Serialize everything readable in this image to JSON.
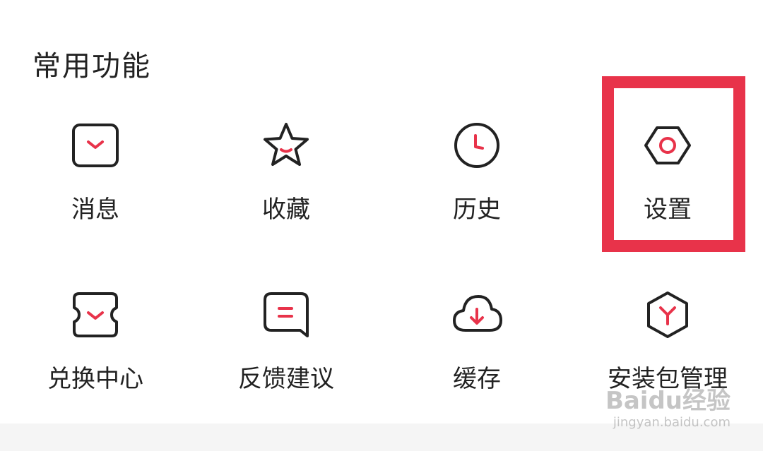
{
  "section": {
    "title": "常用功能"
  },
  "items": [
    {
      "label": "消息",
      "icon": "message-icon"
    },
    {
      "label": "收藏",
      "icon": "star-icon"
    },
    {
      "label": "历史",
      "icon": "clock-icon"
    },
    {
      "label": "设置",
      "icon": "settings-icon"
    },
    {
      "label": "兑换中心",
      "icon": "ticket-icon"
    },
    {
      "label": "反馈建议",
      "icon": "feedback-icon"
    },
    {
      "label": "缓存",
      "icon": "cloud-download-icon"
    },
    {
      "label": "安装包管理",
      "icon": "package-icon"
    }
  ],
  "colors": {
    "accent": "#e8334a",
    "text": "#222222",
    "icon_stroke": "#222222",
    "highlight": "#e8334a"
  },
  "watermark": {
    "main": "Baidu经验",
    "sub": "jingyan.baidu.com"
  }
}
